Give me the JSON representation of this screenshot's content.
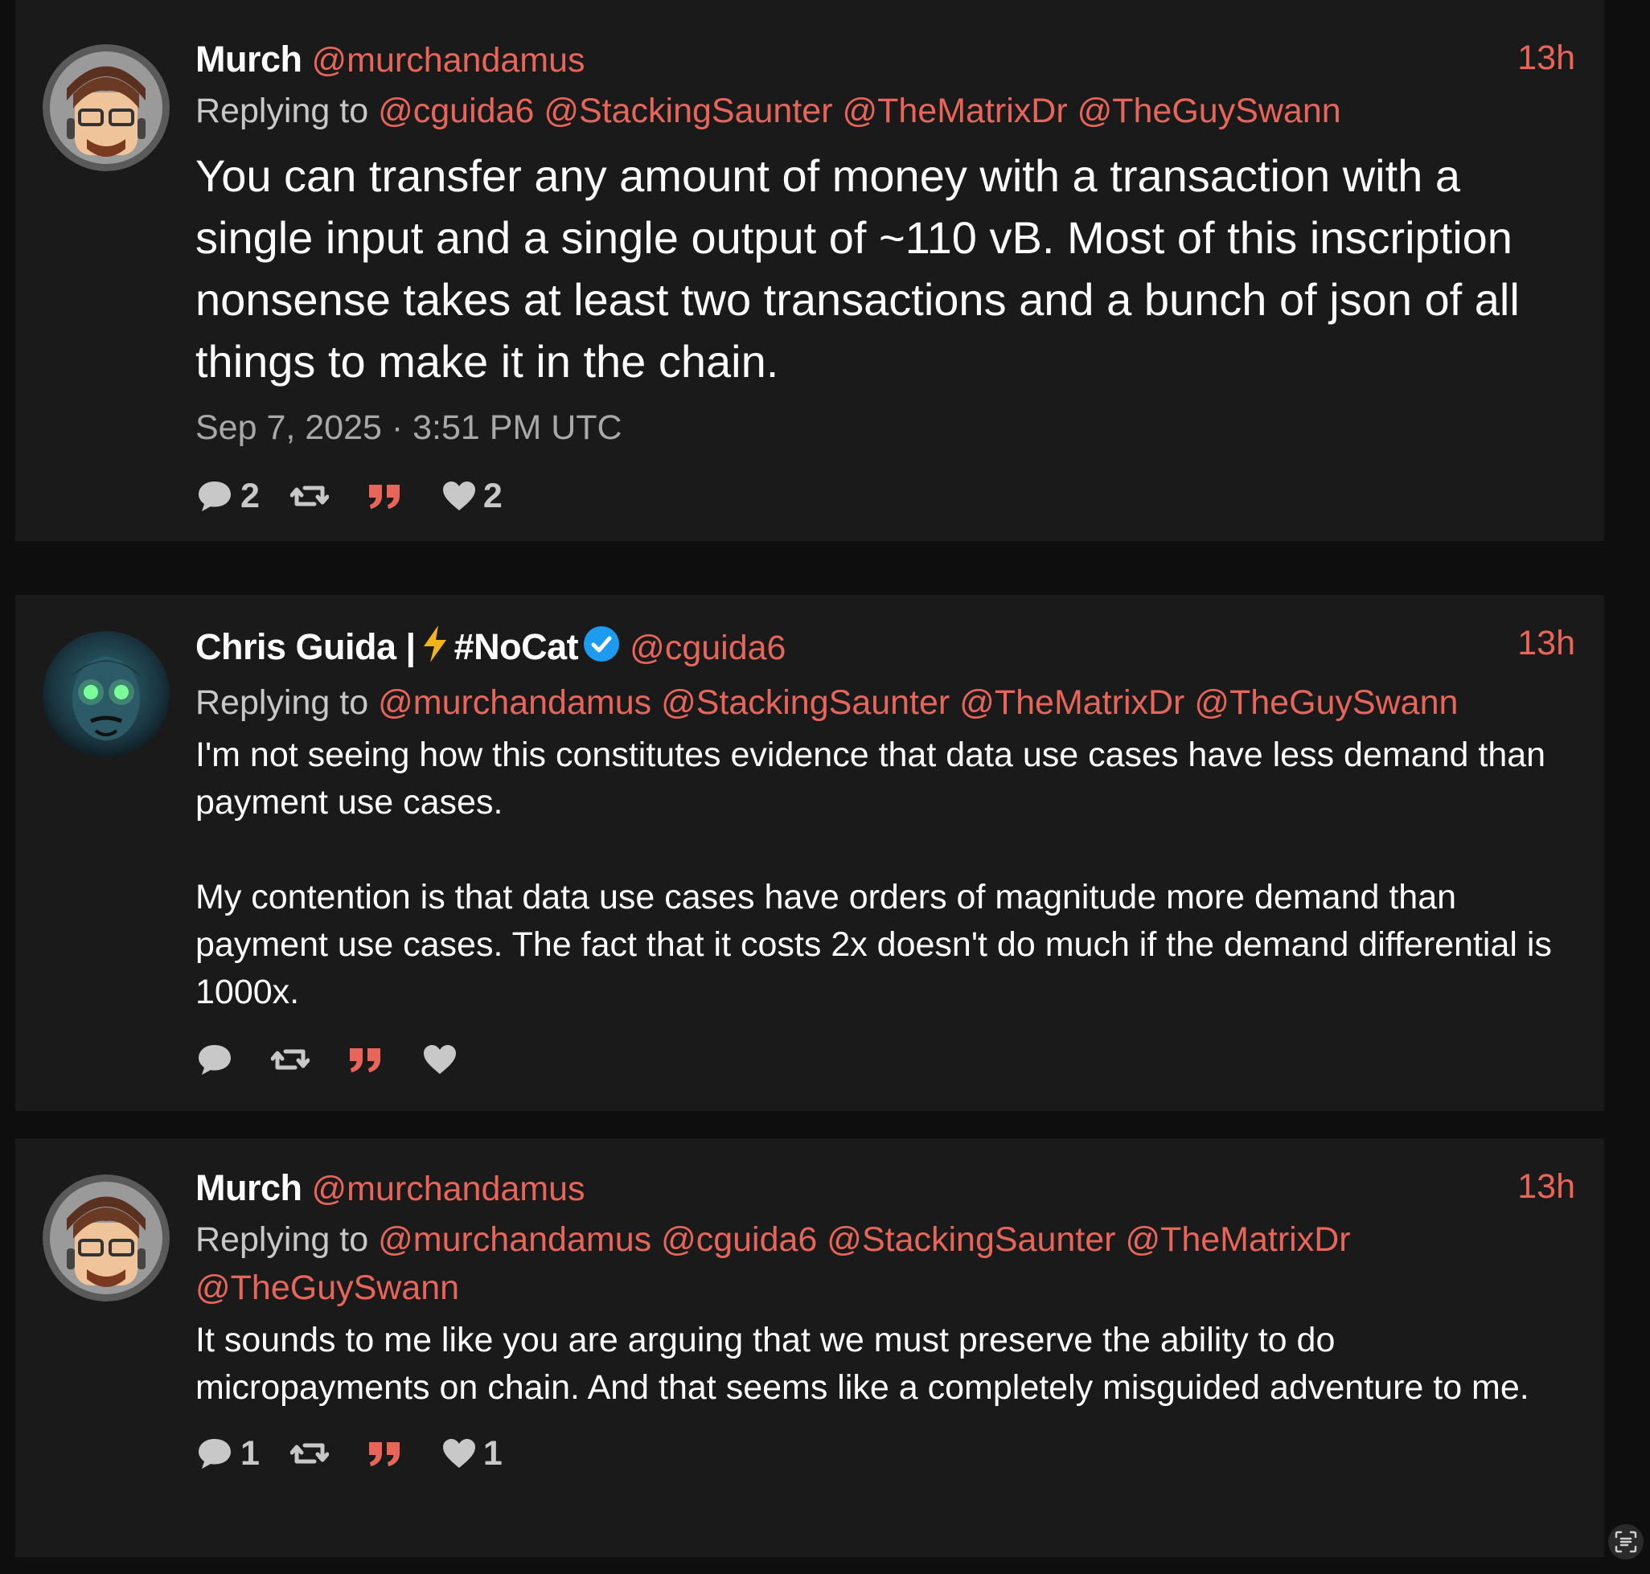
{
  "tweets": [
    {
      "fullname": "Murch",
      "handle": "@murchandamus",
      "time": "13h",
      "replying_prefix": "Replying to",
      "replying_to": [
        "@cguida6",
        "@StackingSaunter",
        "@TheMatrixDr",
        "@TheGuySwann"
      ],
      "content": "You can transfer any amount of money with a transaction with a single input and a single output of ~110 vB. Most of this inscription nonsense takes at least two transactions and a bunch of json of all things to make it in the chain.",
      "date": "Sep 7, 2025 · 3:51 PM UTC",
      "stats": {
        "replies": "2",
        "retweets": "",
        "quotes": "",
        "likes": "2"
      }
    },
    {
      "fullname": "Chris Guida |",
      "fullname_suffix": "#NoCat",
      "verified": true,
      "handle": "@cguida6",
      "time": "13h",
      "replying_prefix": "Replying to",
      "replying_to": [
        "@murchandamus",
        "@StackingSaunter",
        "@TheMatrixDr",
        "@TheGuySwann"
      ],
      "content": "I'm not seeing how this constitutes evidence that data use cases have less demand than payment use cases.\n\nMy contention is that data use cases have orders of magnitude more demand than payment use cases. The fact that it costs 2x doesn't do much if the demand differential is 1000x.",
      "stats": {
        "replies": "",
        "retweets": "",
        "quotes": "",
        "likes": ""
      }
    },
    {
      "fullname": "Murch",
      "handle": "@murchandamus",
      "time": "13h",
      "replying_prefix": "Replying to",
      "replying_to": [
        "@murchandamus",
        "@cguida6",
        "@StackingSaunter",
        "@TheMatrixDr",
        "@TheGuySwann"
      ],
      "content": "It sounds to me like you are arguing that we must preserve the ability to do micropayments on chain. And that seems like a completely misguided adventure to me.",
      "stats": {
        "replies": "1",
        "retweets": "",
        "quotes": "",
        "likes": "1"
      }
    }
  ],
  "icons": {
    "reply": "comment-icon",
    "retweet": "retweet-icon",
    "quote": "quote-icon",
    "like": "heart-icon",
    "scan": "live-text-icon"
  },
  "colors": {
    "accent": "#e8655a",
    "background": "#0e0e0e",
    "card": "#1a1a1a",
    "verified": "#1d9bf0"
  }
}
